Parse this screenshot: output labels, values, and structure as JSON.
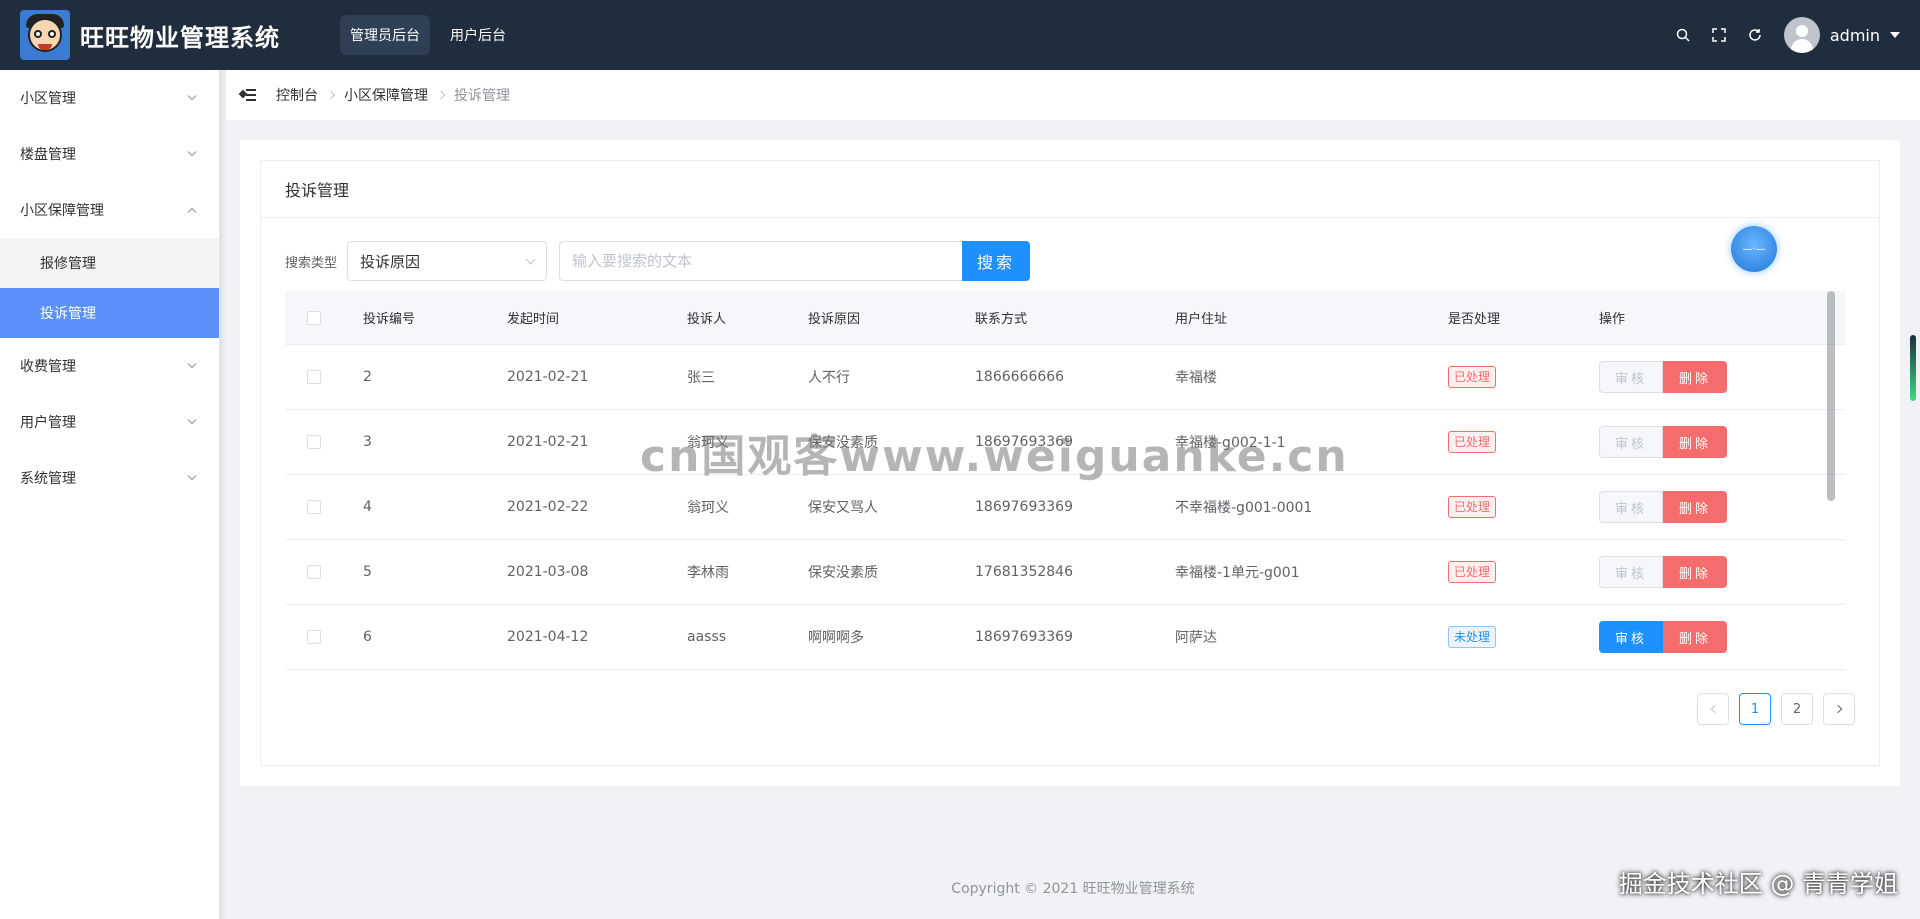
{
  "header": {
    "app_title": "旺旺物业管理系统",
    "nav": [
      {
        "label": "管理员后台",
        "active": true
      },
      {
        "label": "用户后台",
        "active": false
      }
    ],
    "icons": [
      "search-icon",
      "fullscreen-icon",
      "refresh-icon"
    ],
    "username": "admin"
  },
  "sidebar": {
    "items": [
      {
        "label": "小区管理",
        "expanded": false
      },
      {
        "label": "楼盘管理",
        "expanded": false
      },
      {
        "label": "小区保障管理",
        "expanded": true,
        "children": [
          {
            "label": "报修管理",
            "active": false
          },
          {
            "label": "投诉管理",
            "active": true
          }
        ]
      },
      {
        "label": "收费管理",
        "expanded": false
      },
      {
        "label": "用户管理",
        "expanded": false
      },
      {
        "label": "系统管理",
        "expanded": false
      }
    ]
  },
  "breadcrumb": [
    "控制台",
    "小区保障管理",
    "投诉管理"
  ],
  "panel": {
    "title": "投诉管理",
    "search_label": "搜索类型",
    "search_type": "投诉原因",
    "search_placeholder": "输入要搜索的文本",
    "search_button": "搜索"
  },
  "table": {
    "columns": [
      "投诉编号",
      "发起时间",
      "投诉人",
      "投诉原因",
      "联系方式",
      "用户住址",
      "是否处理",
      "操作"
    ],
    "rows": [
      {
        "id": "2",
        "time": "2021-02-21",
        "person": "张三",
        "reason": "人不行",
        "contact": "1866666666",
        "address": "幸福楼",
        "status": "已处理",
        "handled": true
      },
      {
        "id": "3",
        "time": "2021-02-21",
        "person": "翁珂义",
        "reason": "保安没素质",
        "contact": "18697693369",
        "address": "幸福楼-g002-1-1",
        "status": "已处理",
        "handled": true
      },
      {
        "id": "4",
        "time": "2021-02-22",
        "person": "翁珂义",
        "reason": "保安又骂人",
        "contact": "18697693369",
        "address": "不幸福楼-g001-0001",
        "status": "已处理",
        "handled": true
      },
      {
        "id": "5",
        "time": "2021-03-08",
        "person": "李林雨",
        "reason": "保安没素质",
        "contact": "17681352846",
        "address": "幸福楼-1单元-g001",
        "status": "已处理",
        "handled": true
      },
      {
        "id": "6",
        "time": "2021-04-12",
        "person": "aasss",
        "reason": "啊啊啊多",
        "contact": "18697693369",
        "address": "阿萨达",
        "status": "未处理",
        "handled": false
      }
    ],
    "audit_label": "审核",
    "delete_label": "删除"
  },
  "pagination": {
    "pages": [
      "1",
      "2"
    ],
    "current": "1"
  },
  "footer": "Copyright © 2021 旺旺物业管理系统",
  "watermark": "cn国观客www.weiguanke.cn",
  "corner_mark": "掘金技术社区 @ 青青学姐",
  "colors": {
    "header_bg": "#1f2d3d",
    "accent": "#1e90ff",
    "danger": "#f56c6c",
    "sidebar_active": "#5b8ff9"
  }
}
